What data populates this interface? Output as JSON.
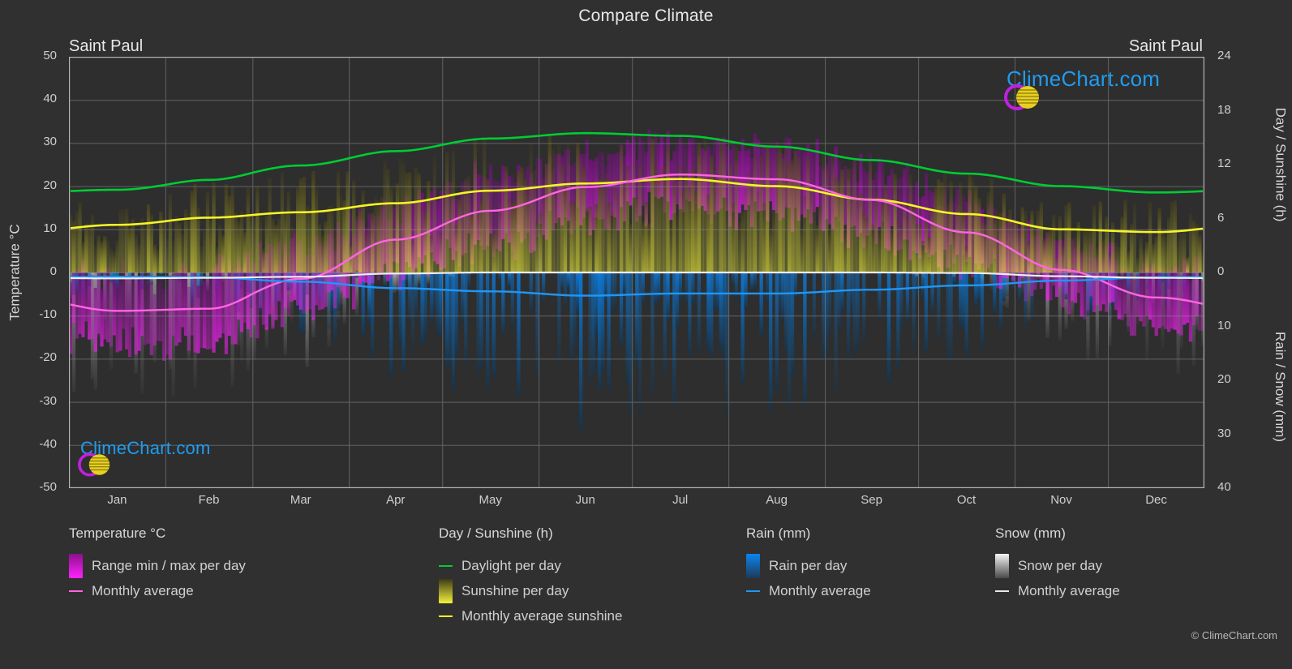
{
  "header": {
    "title": "Compare Climate",
    "city_left": "Saint Paul",
    "city_right": "Saint Paul"
  },
  "axes": {
    "left_title": "Temperature °C",
    "right_title_top": "Day / Sunshine (h)",
    "right_title_bottom": "Rain / Snow (mm)",
    "left_ticks": [
      "50",
      "40",
      "30",
      "20",
      "10",
      "0",
      "-10",
      "-20",
      "-30",
      "-40",
      "-50"
    ],
    "right_ticks_top": [
      "24",
      "18",
      "12",
      "6",
      "0"
    ],
    "right_ticks_bottom": [
      "10",
      "20",
      "30",
      "40"
    ],
    "x_ticks": [
      "Jan",
      "Feb",
      "Mar",
      "Apr",
      "May",
      "Jun",
      "Jul",
      "Aug",
      "Sep",
      "Oct",
      "Nov",
      "Dec"
    ]
  },
  "legend": {
    "temperature": {
      "head": "Temperature °C",
      "range_label": "Range min / max per day",
      "avg_label": "Monthly average",
      "range_color_top": "#8d0f8d",
      "range_color_bottom": "#ff22ff",
      "avg_color": "#ff66e0"
    },
    "sunshine": {
      "head": "Day / Sunshine (h)",
      "daylight_label": "Daylight per day",
      "sunshine_label": "Sunshine per day",
      "avg_label": "Monthly average sunshine",
      "daylight_color": "#00cc33",
      "sun_color_top": "#3f3a15",
      "sun_color_bottom": "#f2f23d",
      "avg_color": "#f5f528"
    },
    "rain": {
      "head": "Rain (mm)",
      "rain_label": "Rain per day",
      "avg_label": "Monthly average",
      "rain_color_top": "#0a85f0",
      "rain_color_bottom": "#1d3a56",
      "avg_color": "#2196f3"
    },
    "snow": {
      "head": "Snow (mm)",
      "snow_label": "Snow per day",
      "avg_label": "Monthly average",
      "snow_color_top": "#f5f5f5",
      "snow_color_bottom": "#4a4a4a",
      "avg_color": "#e8e8e8"
    }
  },
  "logo": {
    "wordmark": "ClimeChart.com",
    "arc_color": "#c020e0",
    "sphere_color": "#e8d020",
    "text_color": "#1f9cf0"
  },
  "footer": {
    "copyright": "© ClimeChart.com"
  },
  "chart_data": {
    "type": "line",
    "title": "Compare Climate",
    "subtitle": "Saint Paul",
    "xlabel": "",
    "ylabel": "Temperature °C",
    "ylabel_right_top": "Day / Sunshine (h)",
    "ylabel_right_bottom": "Rain / Snow (mm)",
    "ylim": [
      -50,
      50
    ],
    "ylim_right_top": [
      0,
      24
    ],
    "ylim_right_bottom": [
      0,
      40
    ],
    "grid": true,
    "legend_position": "bottom",
    "categories": [
      "Jan",
      "Feb",
      "Mar",
      "Apr",
      "May",
      "Jun",
      "Jul",
      "Aug",
      "Sep",
      "Oct",
      "Nov",
      "Dec"
    ],
    "series": [
      {
        "name": "Monthly average temperature",
        "unit": "°C",
        "axis": "left",
        "color": "#ff66e0",
        "values": [
          -8.9,
          -8.4,
          -1.5,
          7.6,
          14.3,
          19.8,
          22.7,
          21.6,
          16.8,
          9.3,
          0.6,
          -5.8
        ]
      },
      {
        "name": "Daylight per day",
        "unit": "h",
        "axis": "right_top",
        "color": "#00cc33",
        "values": [
          9.2,
          10.3,
          11.9,
          13.5,
          14.9,
          15.5,
          15.2,
          14.0,
          12.5,
          11.0,
          9.6,
          8.9
        ]
      },
      {
        "name": "Monthly average sunshine",
        "unit": "h",
        "axis": "right_top",
        "color": "#f5f528",
        "values": [
          5.3,
          6.1,
          6.7,
          7.7,
          9.1,
          9.9,
          10.4,
          9.6,
          8.1,
          6.5,
          4.8,
          4.5
        ]
      },
      {
        "name": "Monthly average rain",
        "unit": "mm",
        "axis": "right_bottom",
        "color": "#2196f3",
        "values": [
          0.8,
          0.9,
          1.7,
          2.9,
          3.5,
          4.3,
          3.9,
          3.9,
          3.2,
          2.4,
          1.5,
          0.9
        ]
      },
      {
        "name": "Monthly average snow",
        "unit": "mm",
        "axis": "right_bottom",
        "color": "#e8e8e8",
        "values": [
          1.1,
          1.0,
          0.8,
          0.2,
          0.0,
          0.0,
          0.0,
          0.0,
          0.0,
          0.1,
          0.7,
          1.0
        ]
      }
    ],
    "daily_ranges": {
      "description": "Daily min/max temperature range bars (magenta) and daily sunshine bars (yellow), daily rain bars (blue), daily snow bars (grey)",
      "temp_min_monthly": [
        -14.5,
        -13.5,
        -6.5,
        2.0,
        8.5,
        14.0,
        17.0,
        16.0,
        11.0,
        4.0,
        -3.5,
        -10.5
      ],
      "temp_max_monthly": [
        -3.5,
        -2.0,
        4.0,
        13.0,
        20.0,
        25.5,
        28.5,
        27.0,
        22.0,
        14.5,
        4.5,
        -1.5
      ]
    }
  }
}
